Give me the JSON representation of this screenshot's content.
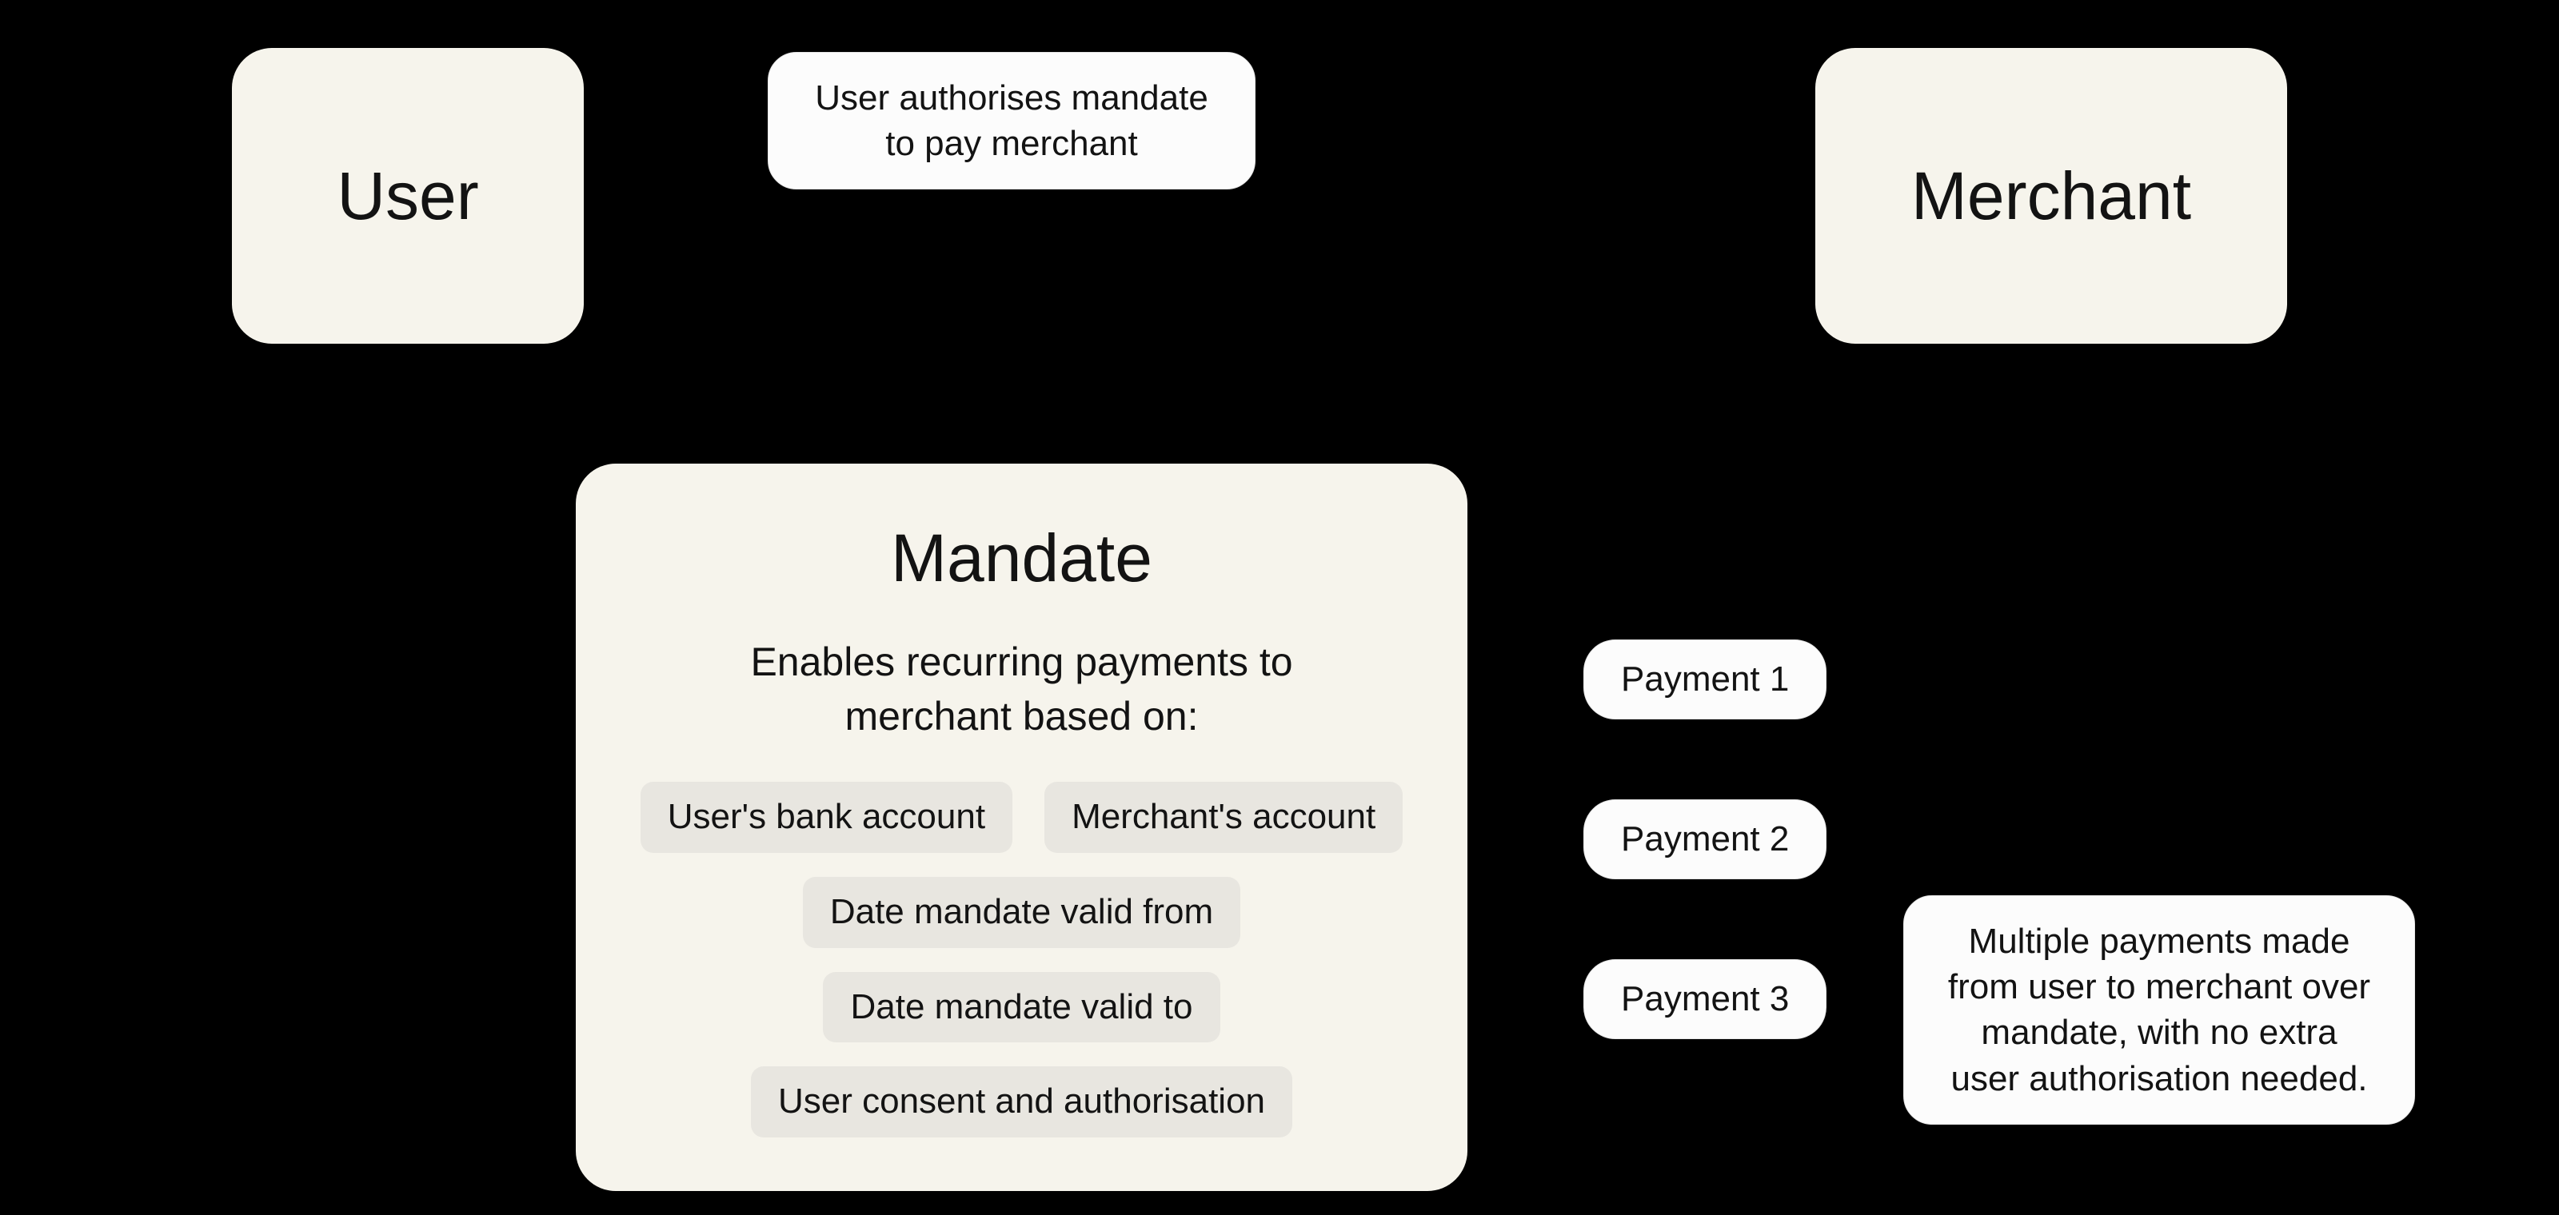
{
  "nodes": {
    "user": "User",
    "merchant": "Merchant"
  },
  "callouts": {
    "authorise": "User authorises mandate to pay merchant",
    "multiple_payments": "Multiple payments made from user to merchant over mandate, with no extra user authorisation needed."
  },
  "mandate": {
    "title": "Mandate",
    "subtitle": "Enables recurring payments to merchant based on:",
    "chips": {
      "bank": "User's bank account",
      "merchant_acct": "Merchant's account",
      "valid_from": "Date mandate valid from",
      "valid_to": "Date mandate valid to",
      "consent": "User consent and authorisation"
    }
  },
  "payments": {
    "p1": "Payment 1",
    "p2": "Payment 2",
    "p3": "Payment 3"
  }
}
